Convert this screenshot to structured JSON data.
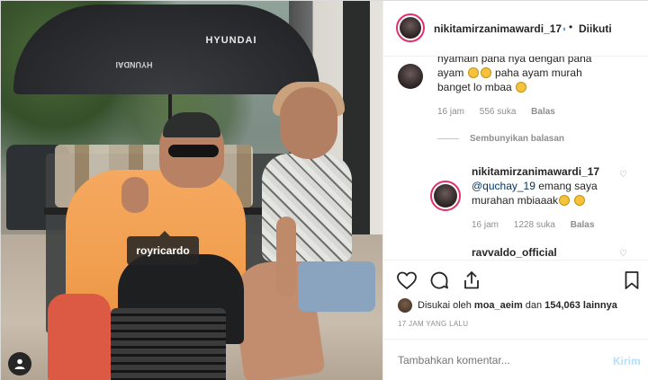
{
  "photo": {
    "umbrella_brand": "HYUNDAI",
    "tagged_user": "royricardo"
  },
  "header": {
    "username": "nikitamirzanimawardi_17",
    "separator": "•",
    "follow_status": "Diikuti"
  },
  "comments": [
    {
      "line1": "nyamain paha nya dengan paha",
      "line2_pre": "ayam",
      "line2_post": "paha ayam murah",
      "line3": "banget lo mbaa",
      "time": "16 jam",
      "likes": "556 suka",
      "reply": "Balas"
    }
  ],
  "hide_replies": "Sembunyikan balasan",
  "reply_comment": {
    "username": "nikitamirzanimawardi_17",
    "mention": "@quchay_19",
    "text_a": "emang saya",
    "text_b": "murahan mbiaaak",
    "time": "16 jam",
    "likes": "1228 suka",
    "reply": "Balas"
  },
  "next_comment_user": "ravvaldo_official",
  "actions": {
    "liked_prefix": "Disukai oleh",
    "liked_user": "moa_aeim",
    "liked_mid": "dan",
    "liked_count": "154,063 lainnya",
    "time_ago": "17 JAM YANG LALU"
  },
  "add_comment": {
    "placeholder": "Tambahkan komentar...",
    "send_label": "Kirim"
  },
  "colors": {
    "accent_blue": "#3897f0",
    "send_disabled": "#b2dffc",
    "muted": "#8e8e8e",
    "story_ring": "#e1306c"
  }
}
